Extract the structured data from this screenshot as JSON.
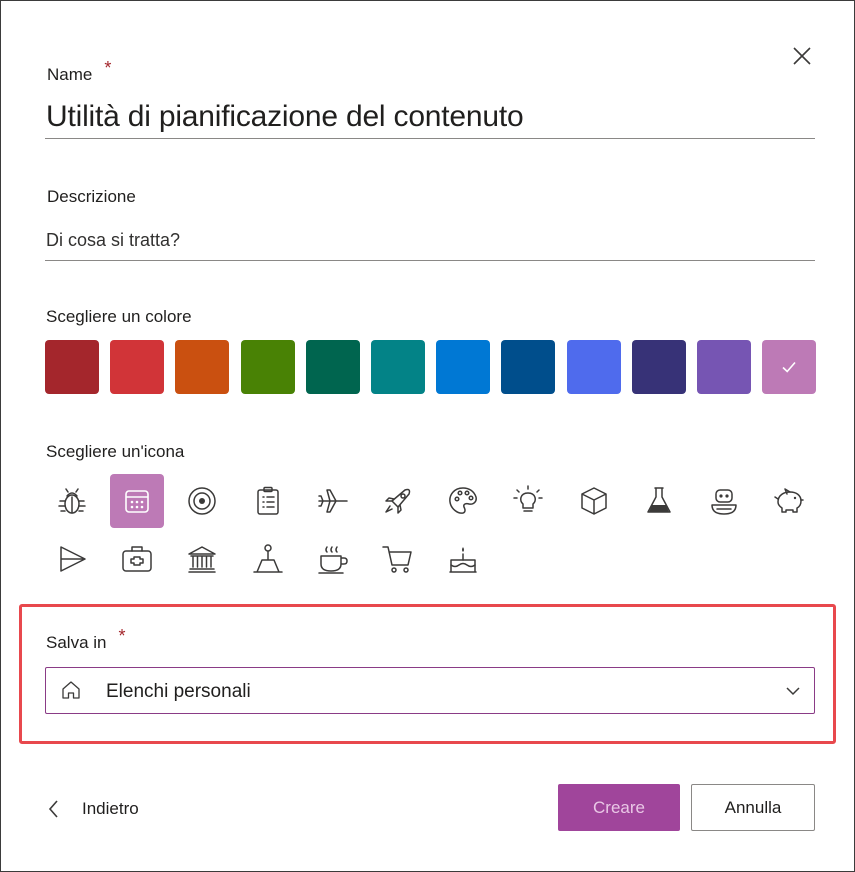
{
  "name": {
    "label": "Name",
    "required_mark": "*",
    "value": "Utilità di pianificazione del contenuto"
  },
  "description": {
    "label": "Descrizione",
    "placeholder": "Di cosa si tratta?"
  },
  "color_picker": {
    "label": "Scegliere un colore",
    "selected_index": 11,
    "colors": [
      "#a4262c",
      "#d13438",
      "#ca5010",
      "#498205",
      "#00654f",
      "#038387",
      "#0078d4",
      "#004e8c",
      "#4f6bed",
      "#373277",
      "#7655b3",
      "#bd7ab6"
    ]
  },
  "icon_picker": {
    "label": "Scegliere un'icona",
    "selected_index": 1,
    "icons": [
      "bug-icon",
      "calendar-icon",
      "target-icon",
      "clipboard-list-icon",
      "airplane-icon",
      "rocket-icon",
      "palette-icon",
      "lightbulb-icon",
      "cube-icon",
      "flask-icon",
      "robot-icon",
      "piggy-bank-icon",
      "send-icon",
      "first-aid-kit-icon",
      "bank-icon",
      "joystick-icon",
      "coffee-cup-icon",
      "shopping-cart-icon",
      "cake-icon"
    ]
  },
  "save_in": {
    "label": "Salva in",
    "required_mark": "*",
    "value": "Elenchi personali",
    "icon": "home-icon"
  },
  "footer": {
    "back_label": "Indietro",
    "create_label": "Creare",
    "cancel_label": "Annulla"
  },
  "accent_color": "#a0459b",
  "required_color": "#a4262c",
  "highlight_color": "#e8484d"
}
